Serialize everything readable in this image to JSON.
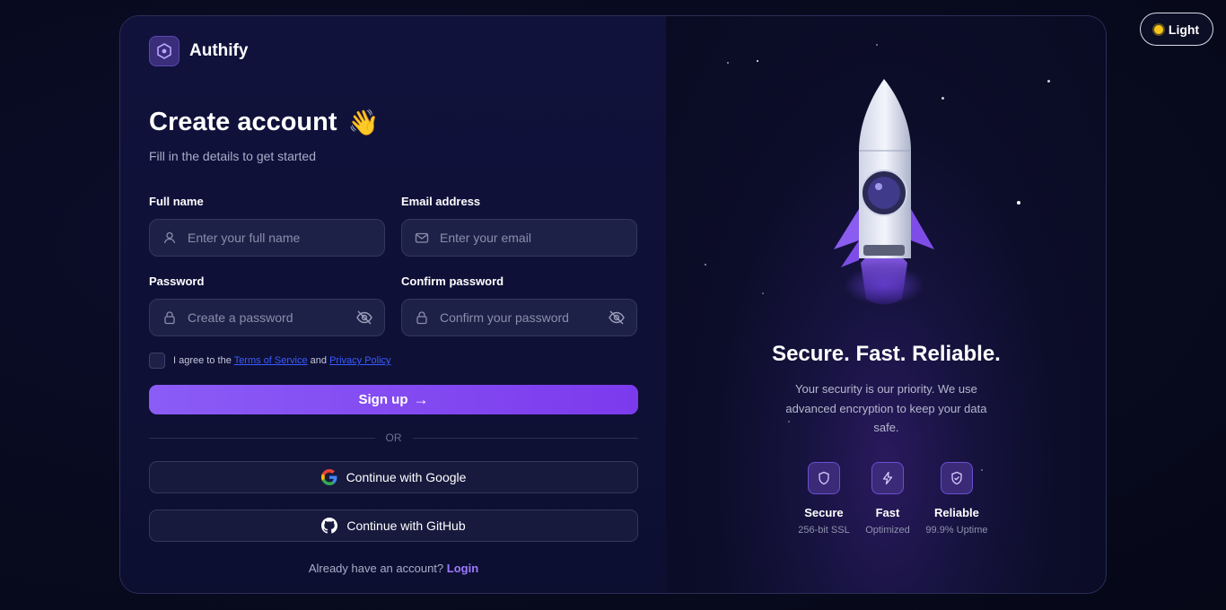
{
  "theme_toggle": {
    "label": "Light",
    "icon": "sun-icon"
  },
  "brand": {
    "name": "Authify",
    "logo_icon": "hexagon-logo-icon"
  },
  "form": {
    "title": "Create account",
    "title_emoji": "👋",
    "subtitle": "Fill in the details to get started",
    "fields": {
      "full_name": {
        "label": "Full name",
        "placeholder": "Enter your full name",
        "icon": "user-icon"
      },
      "email": {
        "label": "Email address",
        "placeholder": "Enter your email",
        "icon": "mail-icon"
      },
      "password": {
        "label": "Password",
        "placeholder": "Create a password",
        "icon": "lock-icon",
        "toggle_icon": "eye-off-icon"
      },
      "confirm_password": {
        "label": "Confirm password",
        "placeholder": "Confirm your password",
        "icon": "lock-icon",
        "toggle_icon": "eye-off-icon"
      }
    },
    "agree": {
      "prefix": "I agree to the",
      "terms": "Terms of Service",
      "and": "and",
      "privacy": "Privacy Policy",
      "checked": false
    },
    "signup_label": "Sign up",
    "signup_arrow": "→",
    "divider": "OR",
    "google_label": "Continue with Google",
    "github_label": "Continue with GitHub",
    "login_prompt": "Already have an account?",
    "login_link": "Login"
  },
  "hero": {
    "title": "Secure. Fast. Reliable.",
    "description": "Your security is our priority. We use advanced encryption to keep your data safe.",
    "features": [
      {
        "name": "Secure",
        "sub": "256-bit SSL",
        "icon": "shield-icon"
      },
      {
        "name": "Fast",
        "sub": "Optimized",
        "icon": "lightning-icon"
      },
      {
        "name": "Reliable",
        "sub": "99.9% Uptime",
        "icon": "shield-check-icon"
      }
    ]
  },
  "colors": {
    "accent": "#8b5cf6",
    "link": "#3b5cff",
    "login_link": "#9c7bff",
    "background": "#0e1035"
  }
}
